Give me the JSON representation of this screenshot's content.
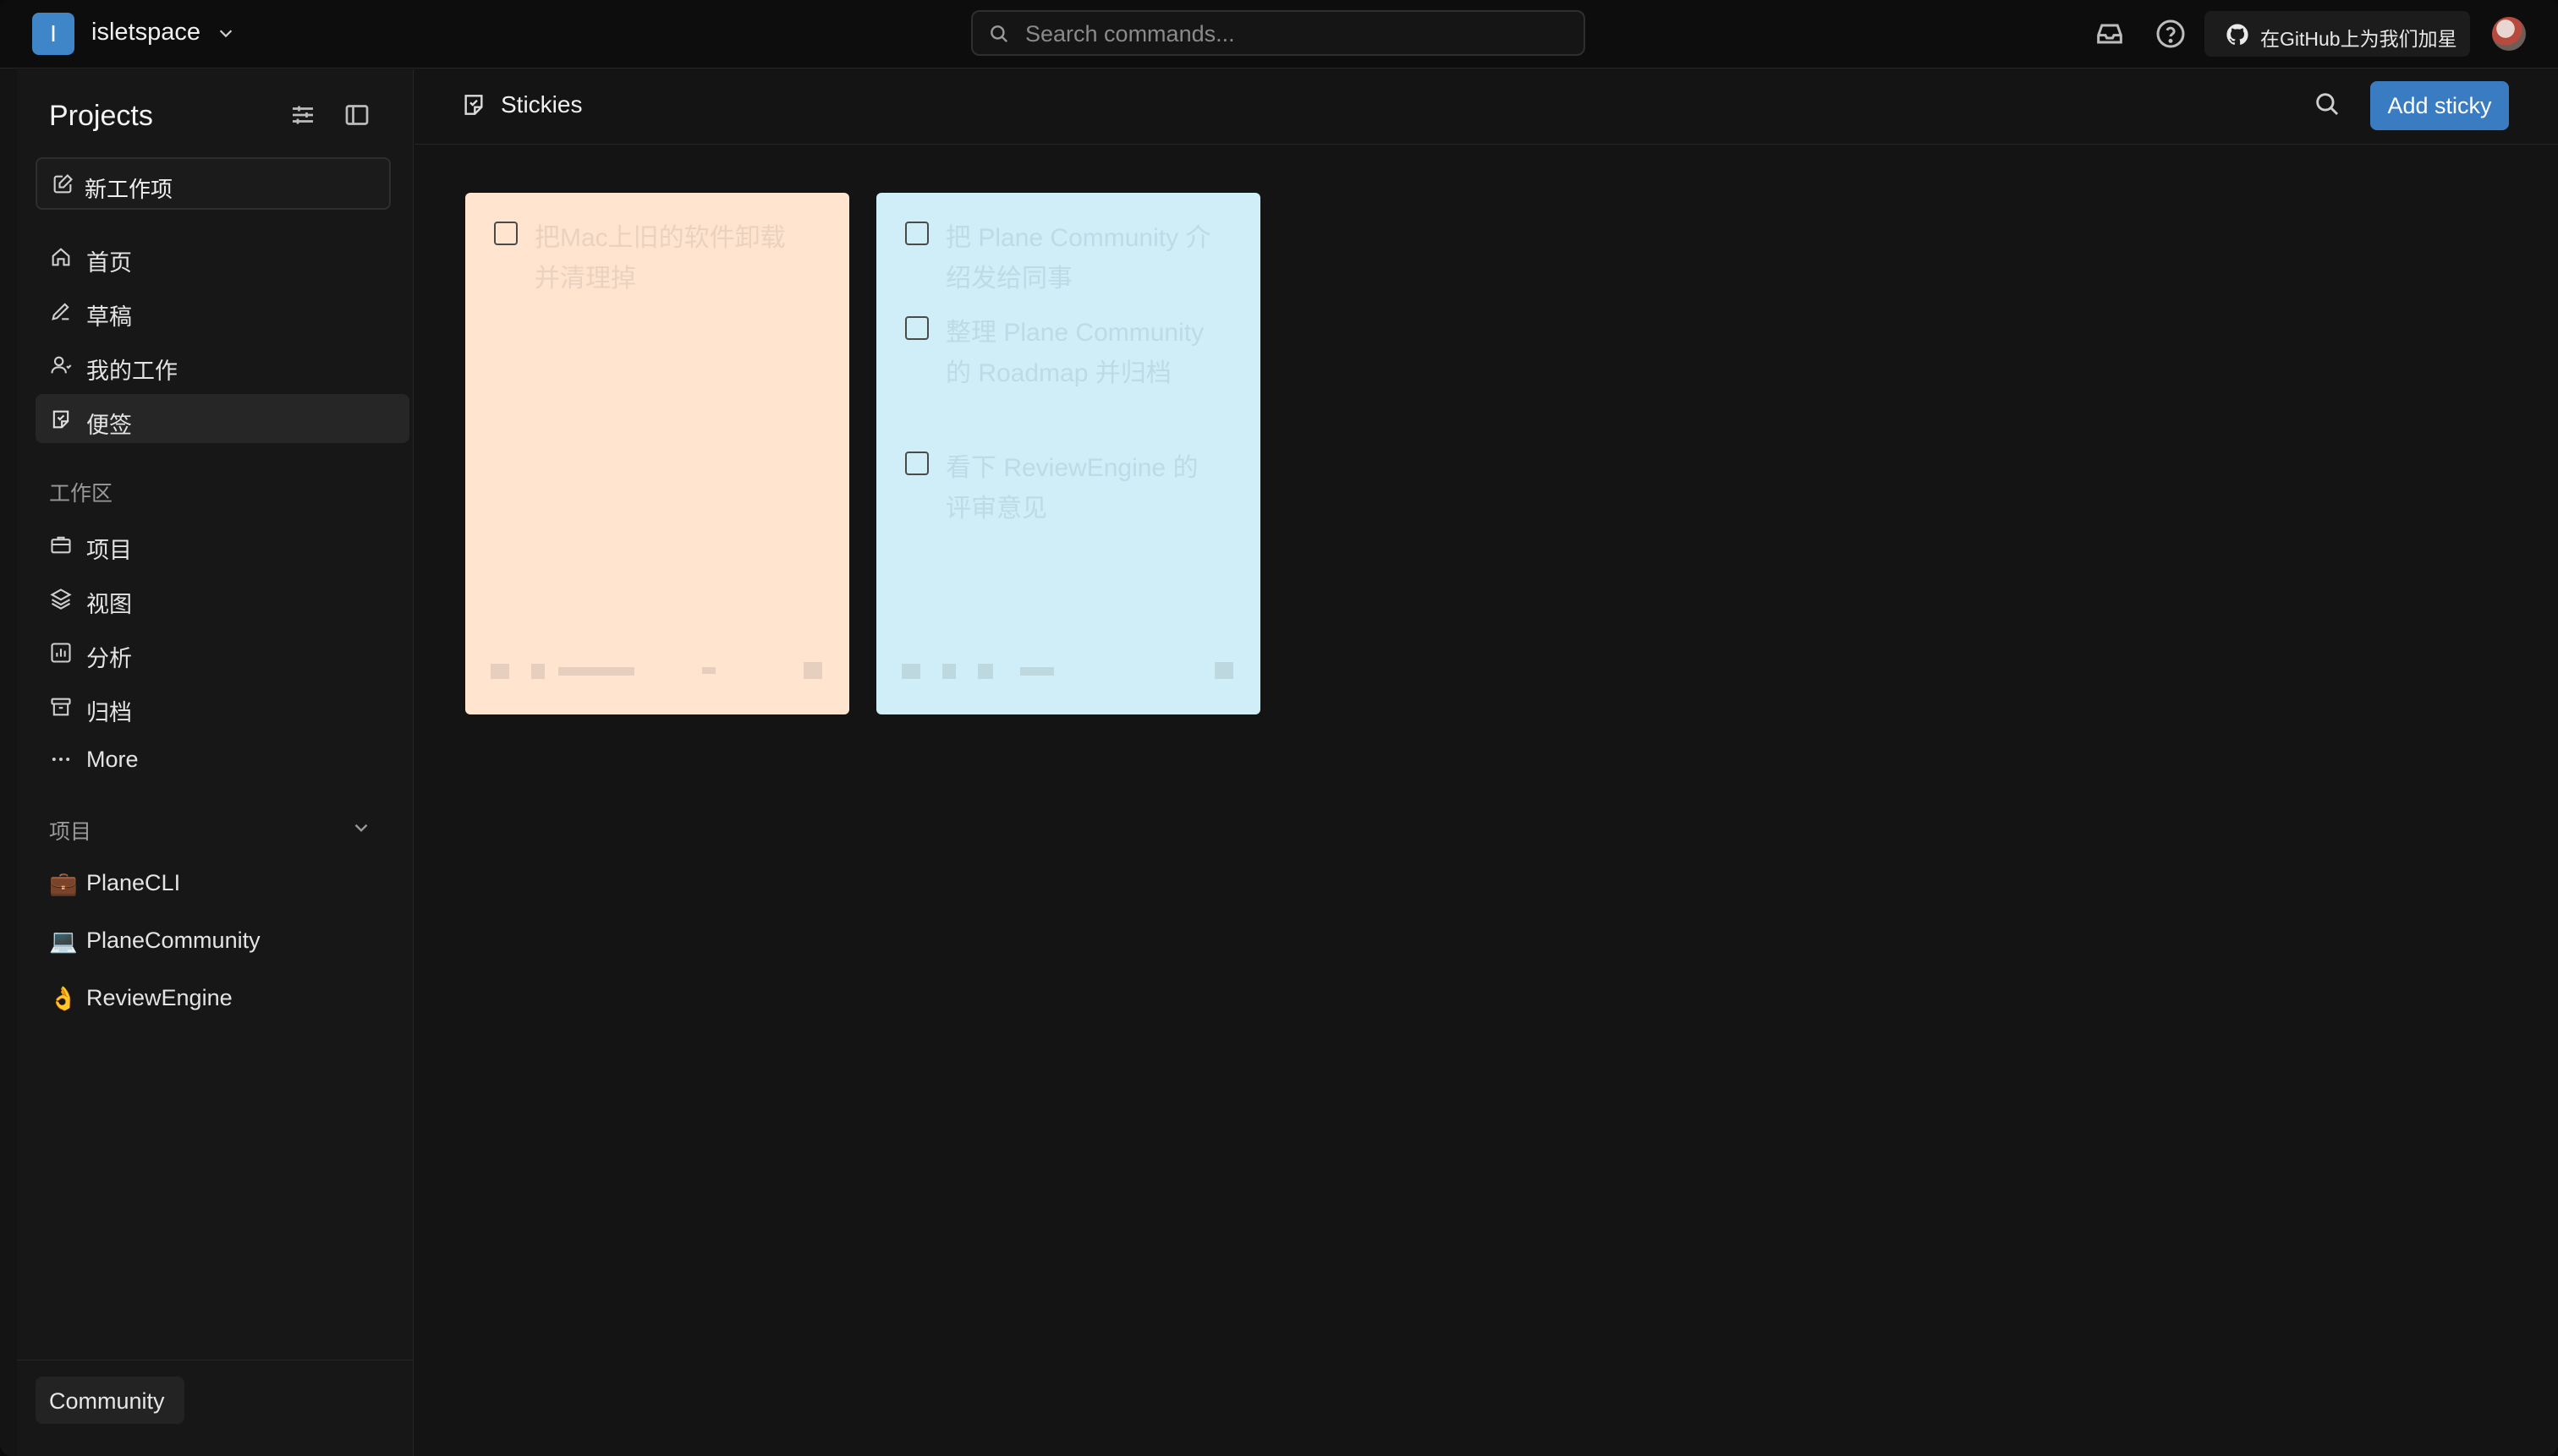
{
  "workspace": {
    "initial": "I",
    "name": "isletspace"
  },
  "search": {
    "placeholder": "Search commands..."
  },
  "github_button": {
    "label": "在GitHub上为我们加星"
  },
  "sidebar": {
    "title": "Projects",
    "new_item_label": "新工作项",
    "nav": [
      {
        "label": "首页",
        "icon": "home-icon"
      },
      {
        "label": "草稿",
        "icon": "pencil-icon"
      },
      {
        "label": "我的工作",
        "icon": "user-icon"
      },
      {
        "label": "便签",
        "icon": "sticky-icon",
        "active": true
      }
    ],
    "workspace_section": "工作区",
    "workspace_items": [
      {
        "label": "项目",
        "icon": "briefcase-icon"
      },
      {
        "label": "视图",
        "icon": "layers-icon"
      },
      {
        "label": "分析",
        "icon": "chart-icon"
      },
      {
        "label": "归档",
        "icon": "archive-icon"
      },
      {
        "label": "More",
        "icon": "more-icon"
      }
    ],
    "projects_section": "项目",
    "projects": [
      {
        "emoji": "💼",
        "name": "PlaneCLI"
      },
      {
        "emoji": "💻",
        "name": "PlaneCommunity"
      },
      {
        "emoji": "👌",
        "name": "ReviewEngine"
      }
    ],
    "footer_label": "Community"
  },
  "main": {
    "title": "Stickies",
    "add_button": "Add sticky"
  },
  "stickies": [
    {
      "color": "#ffe4cf",
      "items": [
        "把Mac上旧的软件卸载并清理掉"
      ]
    },
    {
      "color": "#cfeef8",
      "items": [
        "把 Plane Community 介绍发给同事",
        "整理 Plane Community 的 Roadmap 并归档",
        "看下 ReviewEngine 的评审意见"
      ]
    }
  ]
}
